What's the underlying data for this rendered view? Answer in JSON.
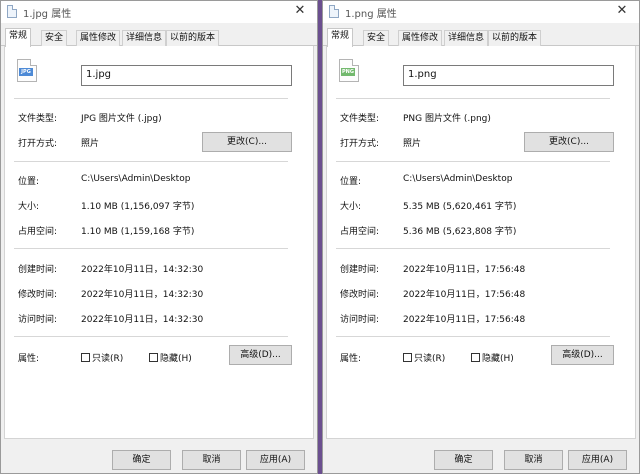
{
  "windows": [
    {
      "title": "1.jpg 属性",
      "tabs": [
        "常规",
        "安全",
        "属性修改",
        "详细信息",
        "以前的版本"
      ],
      "icon_badge": "JPG",
      "filename": "1.jpg",
      "labels": {
        "type": "文件类型:",
        "open_with": "打开方式:",
        "location": "位置:",
        "size": "大小:",
        "size_on_disk": "占用空间:",
        "created": "创建时间:",
        "modified": "修改时间:",
        "accessed": "访问时间:",
        "attributes": "属性:"
      },
      "file_type": "JPG 图片文件 (.jpg)",
      "open_with": "照片",
      "change_button": "更改(C)...",
      "location": "C:\\Users\\Admin\\Desktop",
      "size": "1.10 MB (1,156,097 字节)",
      "size_on_disk": "1.10 MB (1,159,168 字节)",
      "created": "2022年10月11日，14:32:30",
      "modified": "2022年10月11日，14:32:30",
      "accessed": "2022年10月11日，14:32:30",
      "readonly_label": "只读(R)",
      "hidden_label": "隐藏(H)",
      "advanced_button": "高级(D)...",
      "ok_button": "确定",
      "cancel_button": "取消",
      "apply_button": "应用(A)"
    },
    {
      "title": "1.png 属性",
      "tabs": [
        "常规",
        "安全",
        "属性修改",
        "详细信息",
        "以前的版本"
      ],
      "icon_badge": "PNG",
      "filename": "1.png",
      "labels": {
        "type": "文件类型:",
        "open_with": "打开方式:",
        "location": "位置:",
        "size": "大小:",
        "size_on_disk": "占用空间:",
        "created": "创建时间:",
        "modified": "修改时间:",
        "accessed": "访问时间:",
        "attributes": "属性:"
      },
      "file_type": "PNG 图片文件 (.png)",
      "open_with": "照片",
      "change_button": "更改(C)...",
      "location": "C:\\Users\\Admin\\Desktop",
      "size": "5.35 MB (5,620,461 字节)",
      "size_on_disk": "5.36 MB (5,623,808 字节)",
      "created": "2022年10月11日，17:56:48",
      "modified": "2022年10月11日，17:56:48",
      "accessed": "2022年10月11日，17:56:48",
      "readonly_label": "只读(R)",
      "hidden_label": "隐藏(H)",
      "advanced_button": "高级(D)...",
      "ok_button": "确定",
      "cancel_button": "取消",
      "apply_button": "应用(A)"
    }
  ],
  "close_glyph": "✕"
}
